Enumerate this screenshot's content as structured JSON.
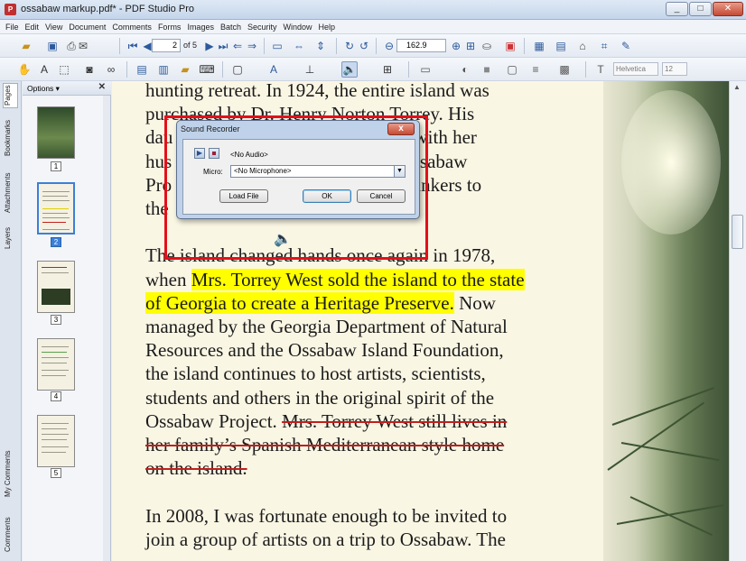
{
  "window": {
    "title": "ossabaw markup.pdf* - PDF Studio Pro",
    "minimize": "_",
    "maximize": "□",
    "close": "✕"
  },
  "menu": [
    "File",
    "Edit",
    "View",
    "Document",
    "Comments",
    "Forms",
    "Images",
    "Batch",
    "Security",
    "Window",
    "Help"
  ],
  "toolbar": {
    "page_current": "2",
    "page_total_text": "of 5",
    "zoom": "162.9",
    "font_name": "Helvetica",
    "font_size": "12"
  },
  "side_tabs": [
    "Pages",
    "Bookmarks",
    "Attachments",
    "Layers",
    "My Comments",
    "Comments"
  ],
  "thumbnails": {
    "options_label": "Options",
    "close_label": "✕",
    "pages": [
      "1",
      "2",
      "3",
      "4",
      "5"
    ],
    "selected": "2"
  },
  "document": {
    "lines": [
      {
        "parts": [
          {
            "t": "hunting retreat. In 1924, the entire island was",
            "s": ""
          }
        ]
      },
      {
        "parts": [
          {
            "t": "purchased by Dr. Henry Norton Torrey. His",
            "s": ""
          }
        ]
      },
      {
        "parts": [
          {
            "t": "dau",
            "s": ""
          },
          {
            "t": "                                         along with her",
            "s": ""
          }
        ]
      },
      {
        "parts": [
          {
            "t": "hus",
            "s": ""
          },
          {
            "t": "                                          the Ossabaw",
            "s": ""
          }
        ]
      },
      {
        "parts": [
          {
            "t": "Pro",
            "s": ""
          },
          {
            "t": "                                       s and thinkers to",
            "s": ""
          }
        ]
      },
      {
        "parts": [
          {
            "t": "the",
            "s": ""
          }
        ]
      },
      {
        "parts": [
          {
            "t": "",
            "s": ""
          }
        ]
      },
      {
        "parts": [
          {
            "t": "The island changed hands once again in 1978,",
            "s": ""
          }
        ]
      },
      {
        "parts": [
          {
            "t": "when ",
            "s": ""
          },
          {
            "t": "Mrs. Torrey West sold the island to the state",
            "s": "hl"
          }
        ]
      },
      {
        "parts": [
          {
            "t": "of Georgia to create a Heritage Preserve.",
            "s": "hl"
          },
          {
            "t": " Now",
            "s": ""
          }
        ]
      },
      {
        "parts": [
          {
            "t": "managed by the Georgia Department of Natural",
            "s": ""
          }
        ]
      },
      {
        "parts": [
          {
            "t": "Resources and the Ossabaw Island Foundation,",
            "s": ""
          }
        ]
      },
      {
        "parts": [
          {
            "t": "the island continues to host artists, scientists,",
            "s": ""
          }
        ]
      },
      {
        "parts": [
          {
            "t": "students and others in the original spirit of the",
            "s": ""
          }
        ]
      },
      {
        "parts": [
          {
            "t": "Ossabaw Project. ",
            "s": ""
          },
          {
            "t": "Mrs. Torrey West still lives in",
            "s": "strike"
          }
        ]
      },
      {
        "parts": [
          {
            "t": "her family’s Spanish Mediterranean style home",
            "s": "strike"
          }
        ]
      },
      {
        "parts": [
          {
            "t": "on the island.",
            "s": "strike"
          }
        ]
      },
      {
        "parts": [
          {
            "t": "",
            "s": ""
          }
        ]
      },
      {
        "parts": [
          {
            "t": "In 2008, I was fortunate enough to be invited to",
            "s": ""
          }
        ]
      },
      {
        "parts": [
          {
            "t": "join a group of artists on a trip to Ossabaw. The",
            "s": ""
          }
        ]
      }
    ]
  },
  "dialog": {
    "title": "Sound Recorder",
    "close": "x",
    "status": "<No Audio>",
    "micro_label": "Micro:",
    "micro_value": "<No Microphone>",
    "load_file": "Load File",
    "ok": "OK",
    "cancel": "Cancel"
  },
  "colors": {
    "highlight": "#ffff00",
    "strikeout": "#c0201c",
    "annotation_rect": "#e3101a"
  }
}
